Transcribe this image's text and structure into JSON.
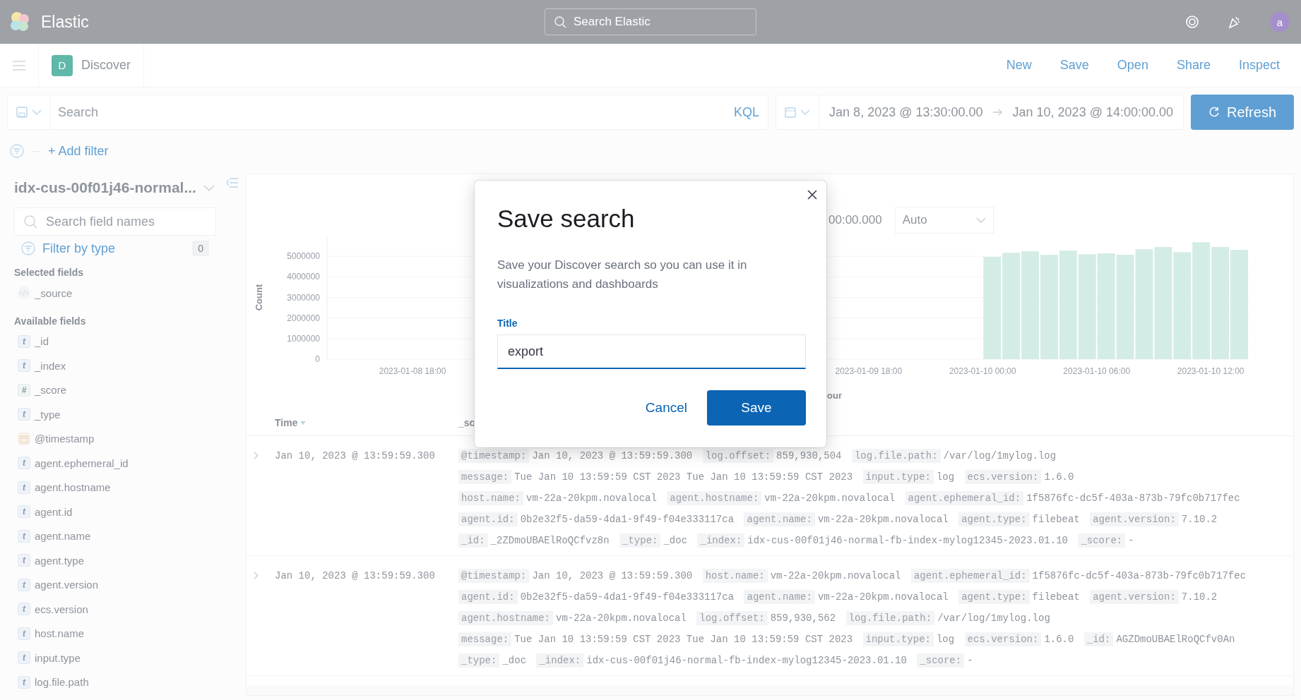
{
  "header": {
    "brand": "Elastic",
    "search_placeholder": "Search Elastic",
    "avatar": "a"
  },
  "nav": {
    "app_badge": "D",
    "app_title": "Discover",
    "links": [
      "New",
      "Save",
      "Open",
      "Share",
      "Inspect"
    ]
  },
  "query_bar": {
    "placeholder": "Search",
    "language": "KQL",
    "start": "Jan 8, 2023 @ 13:30:00.00",
    "end": "Jan 10, 2023 @ 14:00:00.00",
    "refresh": "Refresh"
  },
  "filter_bar": {
    "add_filter": "+ Add filter"
  },
  "sidebar": {
    "index_pattern": "idx-cus-00f01j46-normal...",
    "search_placeholder": "Search field names",
    "filter_label": "Filter by type",
    "filter_count": "0",
    "selected_heading": "Selected fields",
    "selected_fields": [
      {
        "kind": "source",
        "name": "_source"
      }
    ],
    "available_heading": "Available fields",
    "available_fields": [
      {
        "kind": "string",
        "glyph": "t",
        "name": "_id"
      },
      {
        "kind": "string",
        "glyph": "t",
        "name": "_index"
      },
      {
        "kind": "number",
        "glyph": "#",
        "name": "_score"
      },
      {
        "kind": "string",
        "glyph": "t",
        "name": "_type"
      },
      {
        "kind": "date",
        "name": "@timestamp"
      },
      {
        "kind": "string",
        "glyph": "t",
        "name": "agent.ephemeral_id"
      },
      {
        "kind": "string",
        "glyph": "t",
        "name": "agent.hostname"
      },
      {
        "kind": "string",
        "glyph": "t",
        "name": "agent.id"
      },
      {
        "kind": "string",
        "glyph": "t",
        "name": "agent.name"
      },
      {
        "kind": "string",
        "glyph": "t",
        "name": "agent.type"
      },
      {
        "kind": "string",
        "glyph": "t",
        "name": "agent.version"
      },
      {
        "kind": "string",
        "glyph": "t",
        "name": "ecs.version"
      },
      {
        "kind": "string",
        "glyph": "t",
        "name": "host.name"
      },
      {
        "kind": "string",
        "glyph": "t",
        "name": "input.type"
      },
      {
        "kind": "string",
        "glyph": "t",
        "name": "log.file.path"
      }
    ]
  },
  "histogram": {
    "time_range_fragment": "00:00.000",
    "interval": "Auto",
    "chart_data": {
      "type": "bar",
      "xlabel": "our",
      "ylabel": "Count",
      "grid": true,
      "ylim": [
        0,
        6000000
      ],
      "categories": [
        null,
        null,
        null,
        null,
        "2023-01-08 18:00",
        null,
        null,
        null,
        null,
        null,
        null,
        null,
        null,
        null,
        null,
        null,
        null,
        null,
        null,
        null,
        null,
        null,
        null,
        null,
        null,
        null,
        null,
        null,
        "2023-01-09 18:00",
        null,
        null,
        null,
        null,
        null,
        "2023-01-10 00:00",
        null,
        null,
        null,
        null,
        null,
        "2023-01-10 06:00",
        null,
        null,
        null,
        null,
        null,
        "2023-01-10 12:00",
        null
      ],
      "values": [
        null,
        null,
        null,
        null,
        null,
        null,
        null,
        null,
        null,
        null,
        null,
        null,
        null,
        null,
        null,
        null,
        null,
        null,
        null,
        null,
        null,
        null,
        null,
        null,
        null,
        null,
        null,
        null,
        null,
        null,
        null,
        null,
        null,
        null,
        4970000,
        5170000,
        5240000,
        5070000,
        5270000,
        5100000,
        5140000,
        5070000,
        5340000,
        5450000,
        5200000,
        5680000,
        5450000,
        5310000
      ],
      "yticks": [
        0,
        1000000,
        2000000,
        3000000,
        4000000,
        5000000
      ]
    }
  },
  "table": {
    "columns": [
      "Time",
      "_so"
    ],
    "rows": [
      {
        "time": "Jan 10, 2023 @ 13:59:59.300",
        "source": [
          {
            "key": "@timestamp:",
            "value": "Jan 10, 2023 @ 13:59:59.300"
          },
          {
            "key": "log.offset:",
            "value": "859,930,504"
          },
          {
            "key": "log.file.path:",
            "value": "/var/log/1mylog.log"
          },
          {
            "key": "message:",
            "value": "Tue Jan 10 13:59:59 CST 2023 Tue Jan 10 13:59:59 CST 2023"
          },
          {
            "key": "input.type:",
            "value": "log"
          },
          {
            "key": "ecs.version:",
            "value": "1.6.0"
          },
          {
            "key": "host.name:",
            "value": "vm-22a-20kpm.novalocal"
          },
          {
            "key": "agent.hostname:",
            "value": "vm-22a-20kpm.novalocal"
          },
          {
            "key": "agent.ephemeral_id:",
            "value": "1f5876fc-dc5f-403a-873b-79fc0b717fec"
          },
          {
            "key": "agent.id:",
            "value": "0b2e32f5-da59-4da1-9f49-f04e333117ca"
          },
          {
            "key": "agent.name:",
            "value": "vm-22a-20kpm.novalocal"
          },
          {
            "key": "agent.type:",
            "value": "filebeat"
          },
          {
            "key": "agent.version:",
            "value": "7.10.2"
          },
          {
            "key": "_id:",
            "value": "_2ZDmoUBAElRoQCfvz8n"
          },
          {
            "key": "_type:",
            "value": "_doc"
          },
          {
            "key": "_index:",
            "value": "idx-cus-00f01j46-normal-fb-index-mylog12345-2023.01.10"
          },
          {
            "key": "_score:",
            "value": "-"
          }
        ]
      },
      {
        "time": "Jan 10, 2023 @ 13:59:59.300",
        "source": [
          {
            "key": "@timestamp:",
            "value": "Jan 10, 2023 @ 13:59:59.300"
          },
          {
            "key": "host.name:",
            "value": "vm-22a-20kpm.novalocal"
          },
          {
            "key": "agent.ephemeral_id:",
            "value": "1f5876fc-dc5f-403a-873b-79fc0b717fec"
          },
          {
            "key": "agent.id:",
            "value": "0b2e32f5-da59-4da1-9f49-f04e333117ca"
          },
          {
            "key": "agent.name:",
            "value": "vm-22a-20kpm.novalocal"
          },
          {
            "key": "agent.type:",
            "value": "filebeat"
          },
          {
            "key": "agent.version:",
            "value": "7.10.2"
          },
          {
            "key": "agent.hostname:",
            "value": "vm-22a-20kpm.novalocal"
          },
          {
            "key": "log.offset:",
            "value": "859,930,562"
          },
          {
            "key": "log.file.path:",
            "value": "/var/log/1mylog.log"
          },
          {
            "key": "message:",
            "value": "Tue Jan 10 13:59:59 CST 2023 Tue Jan 10 13:59:59 CST 2023"
          },
          {
            "key": "input.type:",
            "value": "log"
          },
          {
            "key": "ecs.version:",
            "value": "1.6.0"
          },
          {
            "key": "_id:",
            "value": "AGZDmoUBAElRoQCfv0An"
          },
          {
            "key": "_type:",
            "value": "_doc"
          },
          {
            "key": "_index:",
            "value": "idx-cus-00f01j46-normal-fb-index-mylog12345-2023.01.10"
          },
          {
            "key": "_score:",
            "value": "-"
          }
        ]
      }
    ]
  },
  "modal": {
    "title": "Save search",
    "description": "Save your Discover search so you can use it in visualizations and dashboards",
    "field_label": "Title",
    "value": "export",
    "cancel": "Cancel",
    "save": "Save"
  }
}
